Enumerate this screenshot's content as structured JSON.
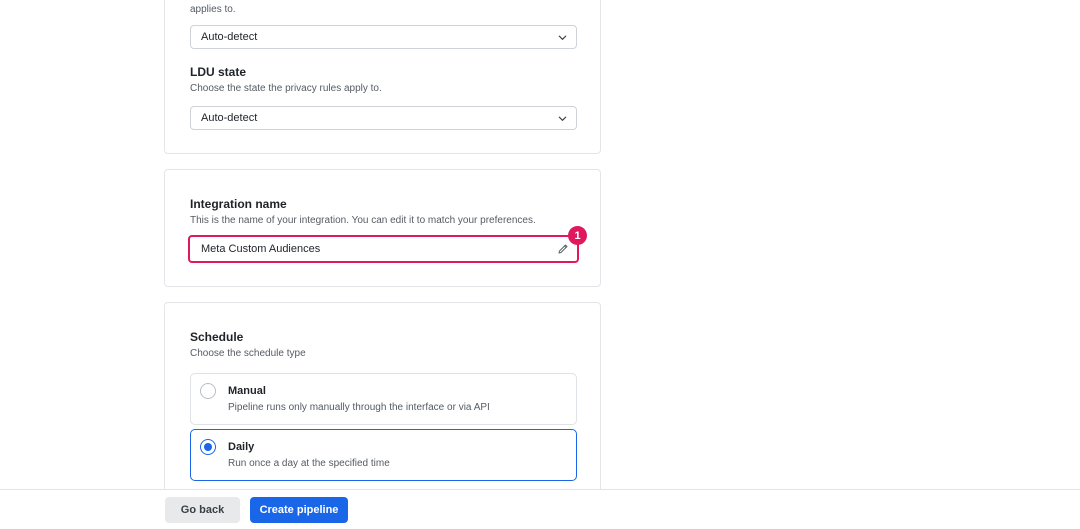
{
  "top_card": {
    "applies_text": "applies to.",
    "country_select_value": "Auto-detect",
    "ldu_title": "LDU state",
    "ldu_desc": "Choose the state the privacy rules apply to.",
    "ldu_select_value": "Auto-detect"
  },
  "integration": {
    "title": "Integration name",
    "desc": "This is the name of your integration. You can edit it to match your preferences.",
    "value": "Meta Custom Audiences",
    "badge": "1"
  },
  "schedule": {
    "title": "Schedule",
    "desc": "Choose the schedule type",
    "options": [
      {
        "title": "Manual",
        "desc": "Pipeline runs only manually through the interface or via API",
        "selected": false
      },
      {
        "title": "Daily",
        "desc": "Run once a day at the specified time",
        "selected": true
      }
    ]
  },
  "footer": {
    "back_label": "Go back",
    "create_label": "Create pipeline"
  },
  "colors": {
    "accent": "#1a66e8",
    "highlight": "#e0195f"
  },
  "icons": {
    "select_chevron": "chevron-down-icon",
    "edit": "pencil-icon"
  }
}
